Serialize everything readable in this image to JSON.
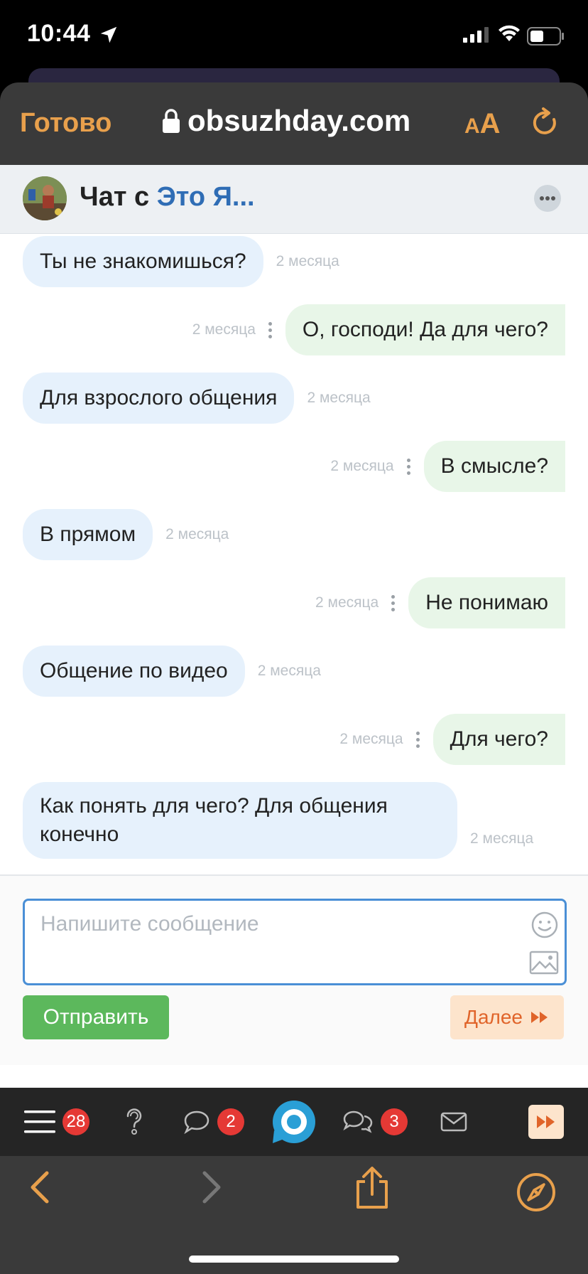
{
  "status_bar": {
    "time": "10:44"
  },
  "browser": {
    "done_label": "Готово",
    "url": "obsuzhday.com",
    "text_size_small": "A",
    "text_size_big": "A"
  },
  "chat": {
    "title_prefix": "Чат с",
    "title_name": "Это Я...",
    "messages": [
      {
        "dir": "in",
        "text": "Ты не знакомишься?",
        "time": "2 месяца"
      },
      {
        "dir": "out",
        "text": "О, господи! Да для чего?",
        "time": "2 месяца"
      },
      {
        "dir": "in",
        "text": "Для взрослого общения",
        "time": "2 месяца"
      },
      {
        "dir": "out",
        "text": "В смысле?",
        "time": "2 месяца"
      },
      {
        "dir": "in",
        "text": "В прямом",
        "time": "2 месяца"
      },
      {
        "dir": "out",
        "text": "Не понимаю",
        "time": "2 месяца"
      },
      {
        "dir": "in",
        "text": "Общение по видео",
        "time": "2 месяца"
      },
      {
        "dir": "out",
        "text": "Для чего?",
        "time": "2 месяца"
      },
      {
        "dir": "in",
        "text": "Как понять для чего? Для общения конечно",
        "time": "2 месяца"
      }
    ]
  },
  "compose": {
    "placeholder": "Напишите сообщение",
    "send_label": "Отправить",
    "next_label": "Далее"
  },
  "site_nav": {
    "menu_badge": "28",
    "messages_badge": "2",
    "discussions_badge": "3"
  },
  "colors": {
    "accent_orange": "#e8a04c",
    "link_blue": "#2f6db5",
    "incoming_bubble": "#e6f1fc",
    "outgoing_bubble": "#e8f6e8",
    "send_green": "#5cb85c",
    "badge_red": "#e53935"
  }
}
